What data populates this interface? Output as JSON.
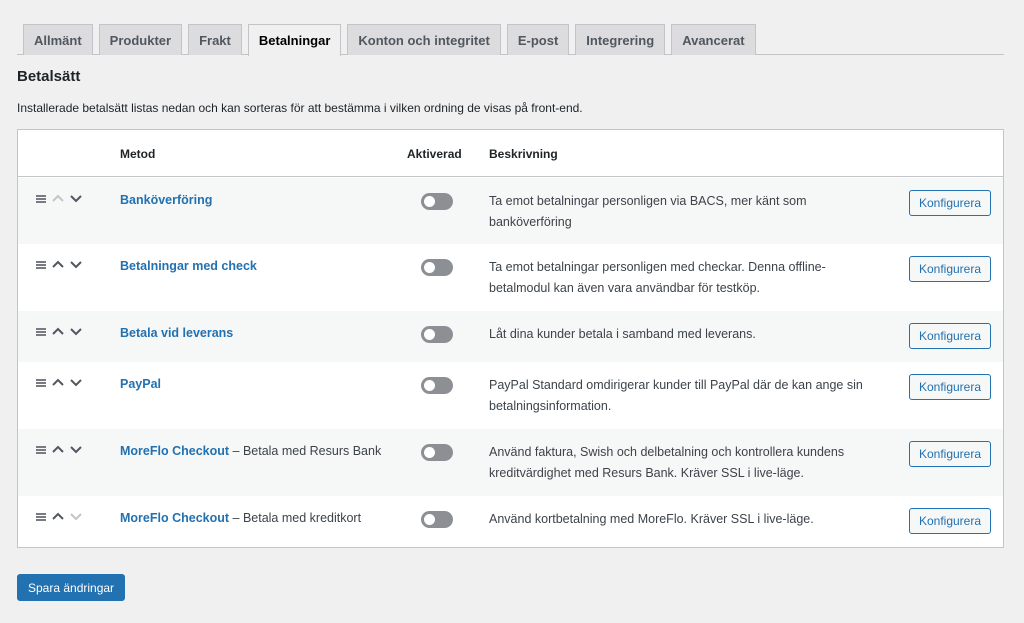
{
  "tabs": [
    {
      "label": "Allmänt",
      "active": false
    },
    {
      "label": "Produkter",
      "active": false
    },
    {
      "label": "Frakt",
      "active": false
    },
    {
      "label": "Betalningar",
      "active": true
    },
    {
      "label": "Konton och integritet",
      "active": false
    },
    {
      "label": "E-post",
      "active": false
    },
    {
      "label": "Integrering",
      "active": false
    },
    {
      "label": "Avancerat",
      "active": false
    }
  ],
  "section": {
    "title": "Betalsätt",
    "intro": "Installerade betalsätt listas nedan och kan sorteras för att bestämma i vilken ordning de visas på front-end."
  },
  "table": {
    "headers": {
      "method": "Metod",
      "enabled": "Aktiverad",
      "description": "Beskrivning"
    },
    "rows": [
      {
        "name": "Banköverföring",
        "suffix": "",
        "enabled": false,
        "up_active": false,
        "down_active": true,
        "description_lines": [
          "Ta emot betalningar personligen via BACS, mer känt som",
          "banköverföring"
        ],
        "button": "Konfigurera"
      },
      {
        "name": "Betalningar med check",
        "suffix": "",
        "enabled": false,
        "up_active": true,
        "down_active": true,
        "description_lines": [
          "Ta emot betalningar personligen med checkar. Denna offline-",
          "betalmodul kan även vara användbar för testköp."
        ],
        "button": "Konfigurera"
      },
      {
        "name": "Betala vid leverans",
        "suffix": "",
        "enabled": false,
        "up_active": true,
        "down_active": true,
        "description_lines": [
          "Låt dina kunder betala i samband med leverans."
        ],
        "button": "Konfigurera"
      },
      {
        "name": "PayPal",
        "suffix": "",
        "enabled": false,
        "up_active": true,
        "down_active": true,
        "description_lines": [
          "PayPal Standard omdirigerar kunder till PayPal där de kan ange sin",
          "betalningsinformation."
        ],
        "button": "Konfigurera"
      },
      {
        "name": "MoreFlo Checkout",
        "suffix": " – Betala med Resurs Bank",
        "enabled": false,
        "up_active": true,
        "down_active": true,
        "description_lines": [
          "Använd faktura, Swish och delbetalning och kontrollera kundens",
          "kreditvärdighet med Resurs Bank. Kräver SSL i live-läge."
        ],
        "button": "Konfigurera"
      },
      {
        "name": "MoreFlo Checkout",
        "suffix": " – Betala med kreditkort",
        "enabled": false,
        "up_active": true,
        "down_active": false,
        "description_lines": [
          "Använd kortbetalning med MoreFlo. Kräver SSL i live-läge."
        ],
        "button": "Konfigurera"
      }
    ]
  },
  "save_button": "Spara ändringar",
  "colors": {
    "link": "#2271b1",
    "primary": "#2271b1",
    "toggle_off": "#8c8f94",
    "page_bg": "#f0f0f1"
  }
}
